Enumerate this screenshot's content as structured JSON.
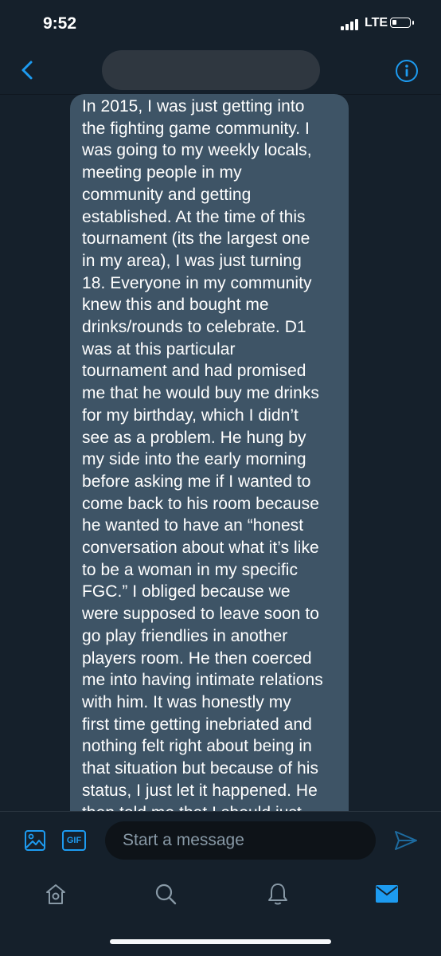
{
  "status_bar": {
    "time": "9:52",
    "network": "LTE",
    "battery_level": 0.25
  },
  "header": {
    "back_icon": "chevron-left-icon",
    "info_icon": "info-circle-icon"
  },
  "conversation": {
    "message": "In 2015, I was just getting into\nthe fighting game community. I\nwas going to my weekly locals,\nmeeting people in my\ncommunity and getting\nestablished. At the time of this\ntournament (its the largest one\nin my area), I was just turning\n18. Everyone in my community\nknew this and bought me\ndrinks/rounds to celebrate. D1\nwas at this particular\ntournament and had promised\nme that he would buy me drinks\nfor my birthday, which I didn’t\nsee as a problem. He hung by\nmy side into the early morning\nbefore asking me if I wanted to\ncome back to his room because\nhe wanted to have an “honest\nconversation about what it’s like\nto be a woman in my specific\nFGC.” I obliged because we\nwere supposed to leave soon to\ngo play friendlies in another\nplayers room. He then coerced\nme into having intimate relations\nwith him. It was honestly my\nfirst time getting inebriated and\nnothing felt right about being in\nthat situation but because of his\nstatus, I just let it happened. He\nthen told me that I should just"
  },
  "compose": {
    "gif_label": "GIF",
    "placeholder": "Start a message",
    "icons": [
      "image-icon",
      "gif-icon",
      "send-icon"
    ]
  },
  "tabs": {
    "icons": [
      "home-icon",
      "search-icon",
      "notifications-icon",
      "messages-icon"
    ],
    "active": "messages"
  },
  "colors": {
    "background": "#15202b",
    "accent": "#1d9bf0",
    "bubble": "#3e5466"
  }
}
